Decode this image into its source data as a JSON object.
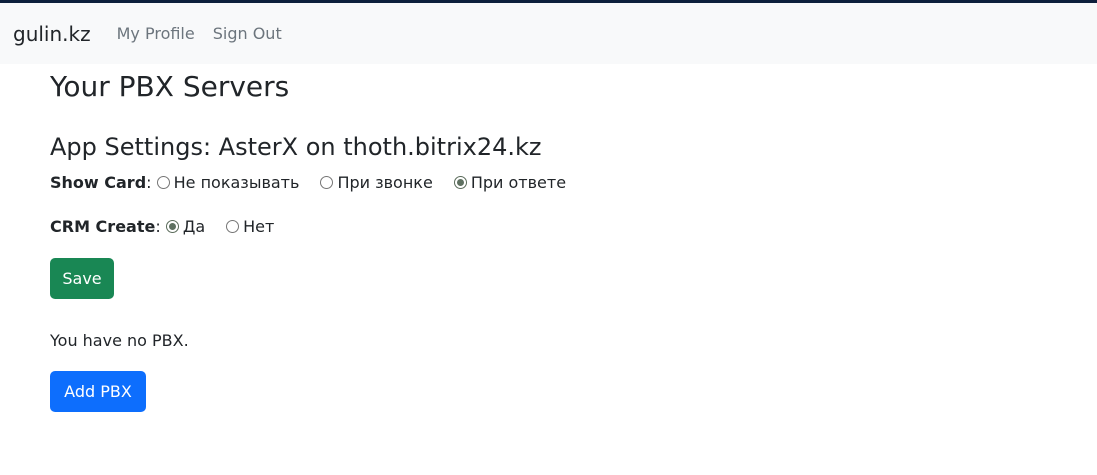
{
  "navbar": {
    "brand": "gulin.kz",
    "links": [
      "My Profile",
      "Sign Out"
    ]
  },
  "page": {
    "title": "Your PBX Servers"
  },
  "settings": {
    "title": "App Settings: AsterX on thoth.bitrix24.kz",
    "show_card": {
      "label": "Show Card",
      "options": [
        "Не показывать",
        "При звонке",
        "При ответе"
      ],
      "selected": "При ответе"
    },
    "crm_create": {
      "label": "CRM Create",
      "options": [
        "Да",
        "Нет"
      ],
      "selected": "Да"
    },
    "save_label": "Save"
  },
  "pbx": {
    "empty_text": "You have no PBX.",
    "add_label": "Add PBX"
  },
  "colors": {
    "navbar_bg": "#f8f9fa",
    "save_button": "#198754",
    "add_button": "#0d6efd"
  }
}
